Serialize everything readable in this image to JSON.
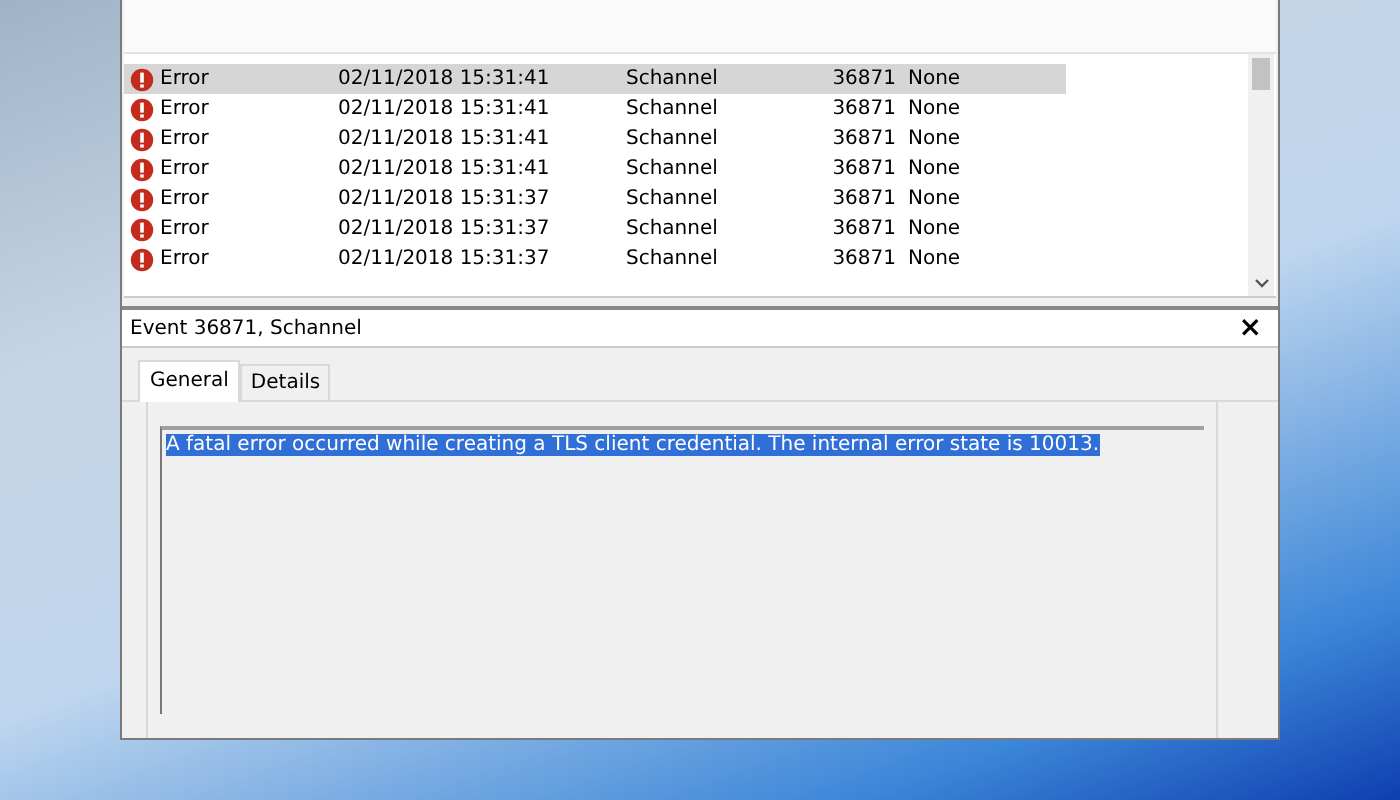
{
  "event_list": {
    "rows": [
      {
        "level": "Error",
        "date_time": "02/11/2018 15:31:41",
        "source": "Schannel",
        "event_id": "36871",
        "task_category": "None",
        "selected": true
      },
      {
        "level": "Error",
        "date_time": "02/11/2018 15:31:41",
        "source": "Schannel",
        "event_id": "36871",
        "task_category": "None",
        "selected": false
      },
      {
        "level": "Error",
        "date_time": "02/11/2018 15:31:41",
        "source": "Schannel",
        "event_id": "36871",
        "task_category": "None",
        "selected": false
      },
      {
        "level": "Error",
        "date_time": "02/11/2018 15:31:41",
        "source": "Schannel",
        "event_id": "36871",
        "task_category": "None",
        "selected": false
      },
      {
        "level": "Error",
        "date_time": "02/11/2018 15:31:37",
        "source": "Schannel",
        "event_id": "36871",
        "task_category": "None",
        "selected": false
      },
      {
        "level": "Error",
        "date_time": "02/11/2018 15:31:37",
        "source": "Schannel",
        "event_id": "36871",
        "task_category": "None",
        "selected": false
      },
      {
        "level": "Error",
        "date_time": "02/11/2018 15:31:37",
        "source": "Schannel",
        "event_id": "36871",
        "task_category": "None",
        "selected": false
      }
    ]
  },
  "event_detail": {
    "title": "Event 36871, Schannel",
    "close": "×",
    "tabs": [
      {
        "label": "General",
        "selected": true
      },
      {
        "label": "Details",
        "selected": false
      }
    ],
    "description": "A fatal error occurred while creating a TLS client credential. The internal error state is 10013.",
    "description_selected": true
  }
}
